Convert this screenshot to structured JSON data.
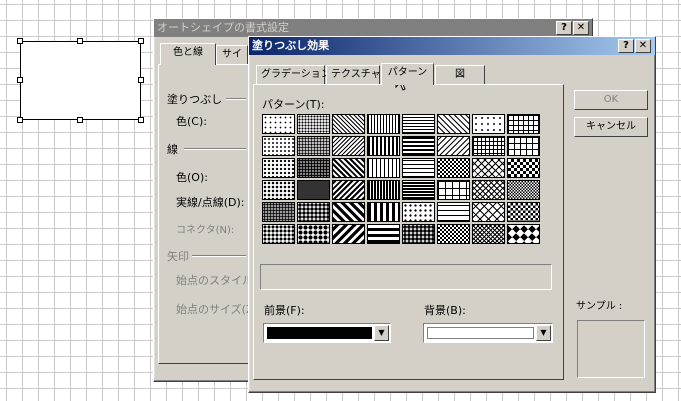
{
  "background_dialog": {
    "title": "オートシェイプの書式設定",
    "help_btn": "?",
    "close_btn": "✕",
    "tabs": [
      "色と線",
      "サイ"
    ],
    "sections": {
      "fill": "塗りつぶし",
      "fill_color": "色(C):",
      "line": "線",
      "line_color": "色(O):",
      "dash": "実線/点線(D):",
      "connector": "コネクタ(N):",
      "arrows": "矢印",
      "begin_style": "始点のスタイル(B)",
      "begin_size": "始点のサイズ(Z)"
    }
  },
  "fill_dialog": {
    "title": "塗りつぶし効果",
    "help_btn": "?",
    "close_btn": "✕",
    "tabs": [
      "グラデーション",
      "テクスチャ",
      "パターン",
      "図"
    ],
    "pattern_label": "パターン(T):",
    "foreground_label": "前景(F):",
    "background_label": "背景(B):",
    "sample_label": "サンプル :",
    "ok": "OK",
    "cancel": "キャンセル",
    "foreground_color": "#000000",
    "background_color": "#ffffff",
    "combo_arrow": "▼"
  },
  "icons": {
    "cursor": "mouse-pointer-icon"
  }
}
